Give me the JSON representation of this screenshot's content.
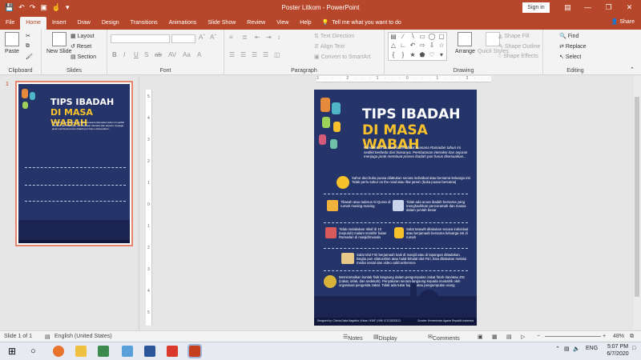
{
  "app": {
    "window_title": "Poster Litkom  -  PowerPoint",
    "sign_in": "Sign in"
  },
  "ribbon_tabs": [
    "File",
    "Home",
    "Insert",
    "Draw",
    "Design",
    "Transitions",
    "Animations",
    "Slide Show",
    "Review",
    "View",
    "Help"
  ],
  "tell_me": "Tell me what you want to do",
  "share": "Share",
  "groups": {
    "clipboard": {
      "label": "Clipboard",
      "paste": "Paste"
    },
    "slides": {
      "label": "Slides",
      "new_slide": "New Slide",
      "layout": "Layout",
      "reset": "Reset",
      "section": "Section"
    },
    "font": {
      "label": "Font"
    },
    "paragraph": {
      "label": "Paragraph",
      "text_direction": "Text Direction",
      "align_text": "Align Text",
      "convert_smartart": "Convert to SmartArt"
    },
    "drawing": {
      "label": "Drawing",
      "arrange": "Arrange",
      "quick_styles": "Quick Styles",
      "shape_fill": "Shape Fill",
      "shape_outline": "Shape Outline",
      "shape_effects": "Shape Effects"
    },
    "editing": {
      "label": "Editing",
      "find": "Find",
      "replace": "Replace",
      "select": "Select"
    }
  },
  "thumbnail": {
    "number": "1"
  },
  "ruler_h": "3 · · · 2 · · · 1 · · · 0 · · · 1 · · · 2 · · · 3",
  "ruler_v": [
    "5",
    "4",
    "3",
    "2",
    "1",
    "0",
    "1",
    "2",
    "3",
    "4",
    "5"
  ],
  "poster": {
    "title_line1": "TIPS IBADAH",
    "title_line2": "DI MASA WABAH",
    "intro": "Pandemi virus corona membuat suasana Ramadan tahun ini sedikit berbeda dari biasanya. Pembatasan interaksi dan anjuran menjaga jarak membuat proses ibadah pun harus disesuaikan...",
    "items": [
      {
        "icon": "prayer-beads-icon",
        "text": "Sahur dan buka puasa dilakukan secara individual atau bersama keluarga inti. Tidak perlu sahur on the road atau iftar jama'i (buka puasa bersama)"
      },
      {
        "icon": "shopping-icon",
        "text": "Tilawah atau tadarus Al-Quran di rumah masing-masing"
      },
      {
        "icon": "quran-stand-icon",
        "text": "Tidak ada acara ibadah bersama yang menghadirkan penceramah dan massa dalam jumlah besar"
      },
      {
        "icon": "radio-icon",
        "text": "Tidak melakukan Itikaf di 10 (sepuluh) malam terakhir bulan Ramadan di masjid/musala"
      },
      {
        "icon": "praying-person-icon",
        "text": "Salat tarawih dilakukan secara individual atau berjamaah bersama keluarga inti di rumah"
      },
      {
        "icon": "mosque-screen-icon",
        "text": "Salat Idul Fitri berjamaah baik di masjid atau di lapangan ditiadakan. Begitu pun silaturahim atau halal-bihalal Idul Fitri, bisa dilakukan melalui media sosial dan video call/conference"
      },
      {
        "icon": "money-bag-icon",
        "text": "Meminimalkan kontak fisik langsung dalam pengumpulan zakat fitrah dan/atau ZIS (zakat, infak, dan sedekah). Penyaluran secara langsung kepada mustahik oleh organisasi pengelola zakat. Tidak ada tukar kupon atau pengumpulan orang"
      }
    ],
    "footer_left": "Designed by: Chinda Datta Magistha | Kelas: HI16F | NIM: 071211833121",
    "footer_right": "Sumber: Kementerian Agama Republik Indonesia"
  },
  "status": {
    "slide": "Slide 1 of 1",
    "language": "English (United States)",
    "notes": "Notes",
    "display_settings": "Display Settings",
    "comments": "Comments",
    "zoom": "48%"
  },
  "taskbar": {
    "lang": "ENG",
    "time": "5:07 PM",
    "date": "6/7/2020"
  },
  "colors": {
    "accent": "#b7472a",
    "poster_bg": "#25356a",
    "poster_title_yellow": "#f6c12b"
  }
}
